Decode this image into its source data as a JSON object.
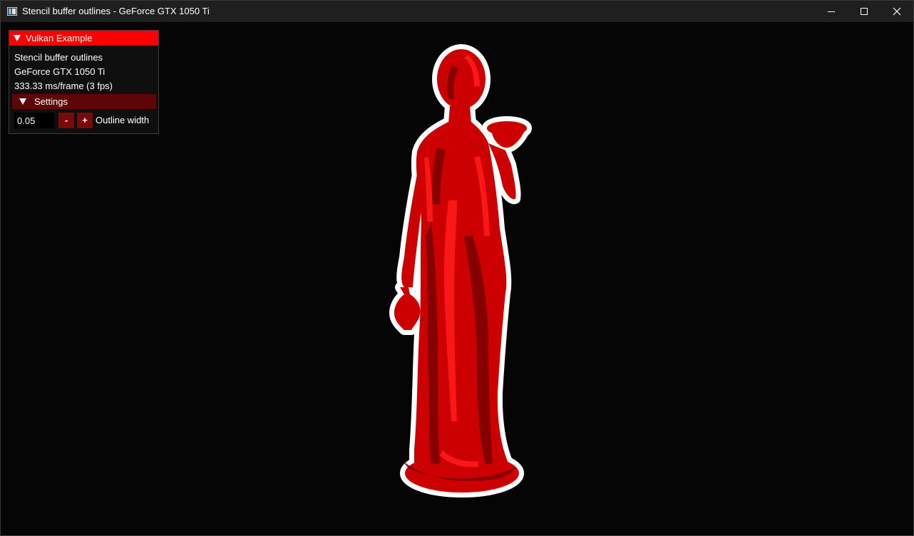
{
  "window": {
    "title": "Stencil buffer outlines - GeForce GTX 1050 Ti",
    "icon": "app-window-icon",
    "controls": [
      "minimize-icon",
      "maximize-icon",
      "close-icon"
    ]
  },
  "overlay": {
    "header_title": "Vulkan Example",
    "app_name": "Stencil buffer outlines",
    "device_name": "GeForce GTX 1050 Ti",
    "frame_stats": "333.33 ms/frame (3 fps)",
    "settings": {
      "label": "Settings",
      "outline_width_value": "0.05",
      "minus_label": "-",
      "plus_label": "+",
      "outline_width_label": "Outline width"
    }
  },
  "scene": {
    "background_color": "#050505",
    "model_color": "#cc0000",
    "model_highlight_color": "#ff1a1a",
    "model_shadow_color": "#7a0000",
    "outline_color": "#ffffff"
  },
  "colors": {
    "titlebar": "#1f1f1f",
    "panel_header": "#ff0000",
    "settings_header": "#5e0606",
    "step_button": "#7a0a0a"
  }
}
